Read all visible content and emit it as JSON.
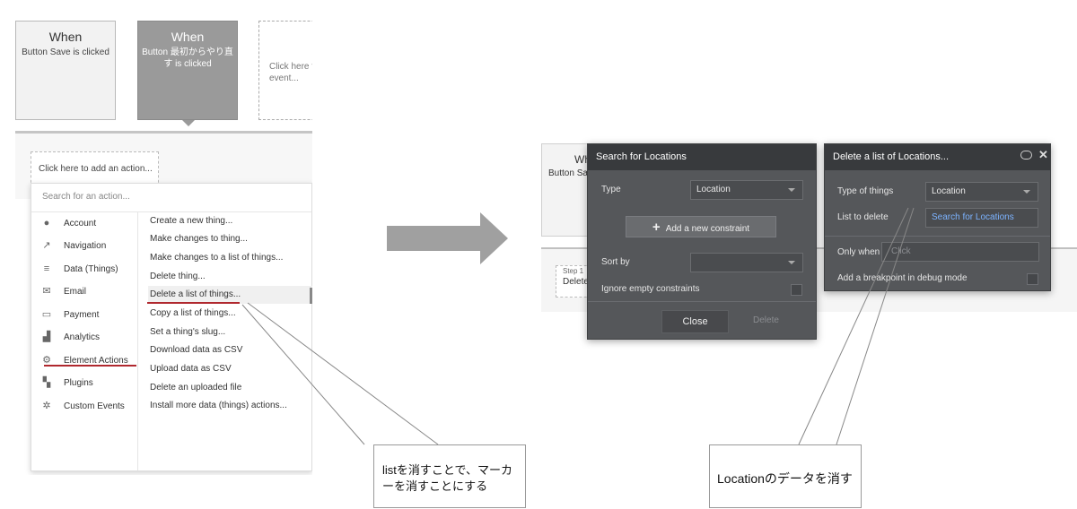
{
  "left": {
    "events": [
      {
        "title": "When",
        "desc": "Button Save is clicked"
      },
      {
        "title": "When",
        "desc": "Button 最初からやり直す is clicked"
      },
      {
        "title": "",
        "desc": "Click here to add an event..."
      }
    ],
    "add_action_label": "Click here to add an action...",
    "search_placeholder": "Search for an action...",
    "categories": [
      {
        "icon": "account-icon",
        "label": "Account"
      },
      {
        "icon": "navigation-icon",
        "label": "Navigation"
      },
      {
        "icon": "database-icon",
        "label": "Data (Things)"
      },
      {
        "icon": "email-icon",
        "label": "Email"
      },
      {
        "icon": "payment-icon",
        "label": "Payment"
      },
      {
        "icon": "analytics-icon",
        "label": "Analytics"
      },
      {
        "icon": "element-actions-icon",
        "label": "Element Actions"
      },
      {
        "icon": "plugins-icon",
        "label": "Plugins"
      },
      {
        "icon": "custom-events-icon",
        "label": "Custom Events"
      }
    ],
    "actions": [
      "Create a new thing...",
      "Make changes to thing...",
      "Make changes to a list of things...",
      "Delete thing...",
      "Delete a list of things...",
      "Copy a list of things...",
      "Set a thing's slug...",
      "Download data as CSV",
      "Upload data as CSV",
      "Delete an uploaded file",
      "Install more data (things) actions..."
    ]
  },
  "right": {
    "bg_event_title": "Wh",
    "bg_event_desc": "Button Sav",
    "step_label": "Step 1",
    "step_text": "Delete",
    "search_dialog": {
      "title": "Search for Locations",
      "type_label": "Type",
      "type_value": "Location",
      "add_constraint": "Add a new constraint",
      "sort_label": "Sort by",
      "sort_value": "",
      "ignore_label": "Ignore empty constraints",
      "close_label": "Close",
      "delete_label": "Delete"
    },
    "delete_dialog": {
      "title": "Delete a list of Locations...",
      "type_label": "Type of things",
      "type_value": "Location",
      "list_label": "List to delete",
      "list_value": "Search for Locations",
      "only_when_label": "Only when",
      "only_when_placeholder": "Click",
      "breakpoint_label": "Add a breakpoint in debug mode"
    }
  },
  "callouts": {
    "left_text": "listを消すことで、マーカーを消すことにする",
    "right_text": "Locationのデータを消す"
  },
  "colors": {
    "underline": "#b0282e",
    "dark_panel": "#55575a",
    "dark_header": "#383a3d",
    "link_blue": "#7cb3ff"
  }
}
